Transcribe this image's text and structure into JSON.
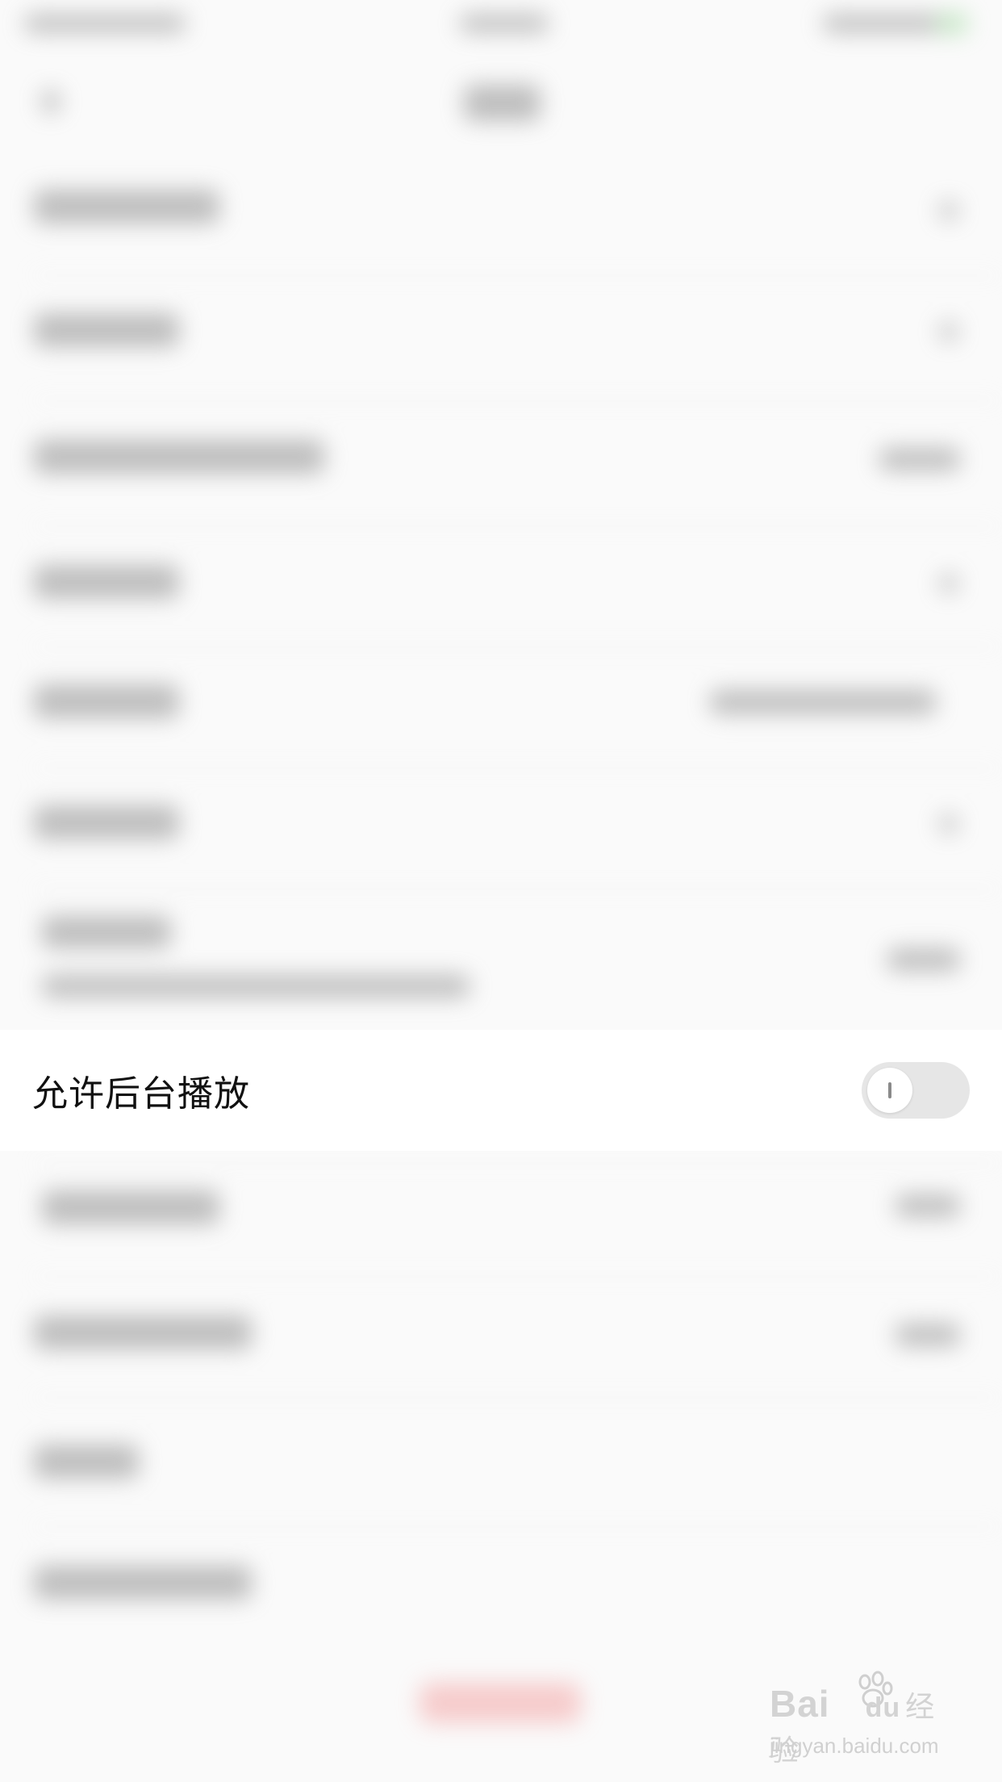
{
  "focused_setting": {
    "label": "允许后台播放",
    "toggle_state": "off"
  },
  "watermark": {
    "logo_text": "Bai",
    "logo_text_tail": "du",
    "brand_suffix": "经验",
    "url": "jingyan.baidu.com"
  }
}
